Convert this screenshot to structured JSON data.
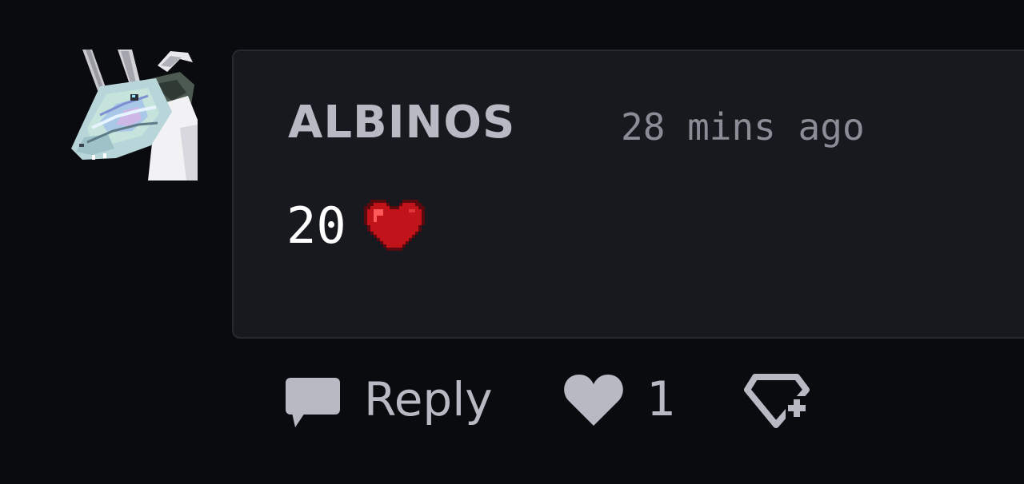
{
  "comment": {
    "username": "ALBINOS",
    "timestamp": "28 mins ago",
    "text": "20",
    "emoji_icon": "red-heart-icon",
    "avatar_icon": "white-dragon-avatar"
  },
  "actions": {
    "reply_label": "Reply",
    "reply_icon": "speech-bubble-icon",
    "like_icon": "heart-icon",
    "like_count": "1",
    "reward_icon": "gem-add-icon"
  },
  "colors": {
    "background": "#0a0b0f",
    "card": "#17191f",
    "username": "#b9b9c3",
    "timestamp": "#8b8c95",
    "heart": "#c0141a"
  }
}
